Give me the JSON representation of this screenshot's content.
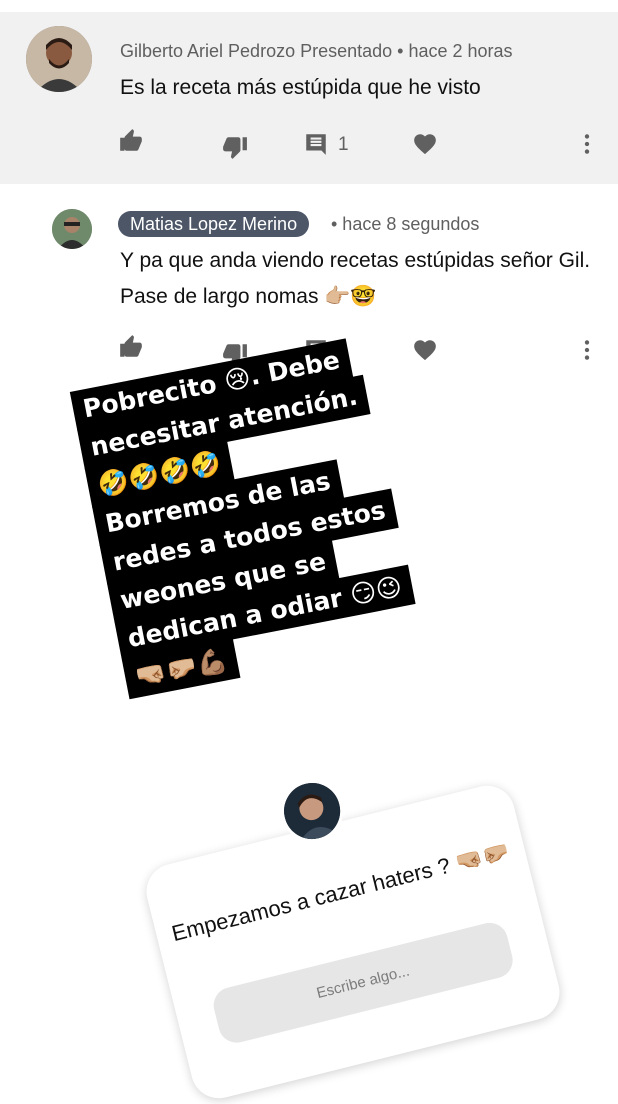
{
  "comment1": {
    "author": "Gilberto Ariel Pedrozo Presentado",
    "time": "• hace 2 horas",
    "text": "Es la receta más estúpida que he visto",
    "reply_count": "1"
  },
  "comment2": {
    "author": "Matias Lopez Merino",
    "time": "• hace 8 segundos",
    "text": "Y pa que anda viendo recetas estúpidas señor Gil. Pase de largo nomas 👉🏼🤓"
  },
  "sticker": {
    "lines": [
      "Pobrecito 😢. Debe",
      "necesitar atención.",
      "🤣🤣🤣🤣",
      "Borremos de las",
      "redes a todos estos",
      "weones que se",
      "dedican a odiar 😏😉",
      "🤜🏼🤛🏼💪🏽"
    ]
  },
  "question_card": {
    "text": "Empezamos a cazar haters ? 🤜🏼🤛🏼",
    "placeholder": "Escribe algo..."
  },
  "colors": {
    "comment1_bg": "#f1f1f1",
    "author_chip_bg": "#4c5667",
    "sticker_bg": "#000000"
  }
}
